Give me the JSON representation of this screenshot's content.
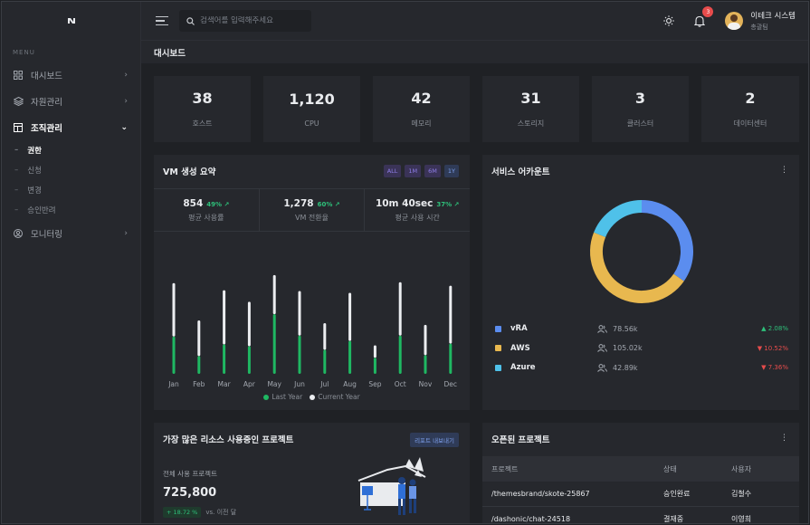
{
  "sidebar": {
    "menu_title": "MENU",
    "items": [
      {
        "label": "대시보드",
        "expanded": false
      },
      {
        "label": "자원관리",
        "expanded": false
      },
      {
        "label": "조직관리",
        "expanded": true
      },
      {
        "label": "모니터링",
        "expanded": false
      }
    ],
    "subitems": [
      "권한",
      "신청",
      "변경",
      "승인반려"
    ]
  },
  "topbar": {
    "search_placeholder": "검색어를 입력해주세요",
    "notification_count": "3",
    "user_name": "이테크 시스템",
    "user_role": "총괄팀"
  },
  "page_title": "대시보드",
  "stats": [
    {
      "value": "38",
      "label": "호스트"
    },
    {
      "value": "1,120",
      "label": "CPU"
    },
    {
      "value": "42",
      "label": "메모리"
    },
    {
      "value": "31",
      "label": "스토리지"
    },
    {
      "value": "3",
      "label": "클러스터"
    },
    {
      "value": "2",
      "label": "데이터센터"
    }
  ],
  "vm_card": {
    "title": "VM 생성 요약",
    "ranges": [
      "ALL",
      "1M",
      "6M",
      "1Y"
    ],
    "selected_range": "1Y",
    "metrics": [
      {
        "value": "854",
        "growth": "49% ↗",
        "label": "평균 사용률"
      },
      {
        "value": "1,278",
        "growth": "60% ↗",
        "label": "VM 전환율"
      },
      {
        "value": "10m 40sec",
        "growth": "37% ↗",
        "label": "평균 사용 시간"
      }
    ]
  },
  "chart_data": {
    "type": "bar",
    "categories": [
      "Jan",
      "Feb",
      "Mar",
      "Apr",
      "May",
      "Jun",
      "Jul",
      "Aug",
      "Sep",
      "Oct",
      "Nov",
      "Dec"
    ],
    "series": [
      {
        "name": "Last Year",
        "color": "#1fb862",
        "values": [
          42,
          20,
          33,
          31,
          67,
          43,
          27,
          37,
          18,
          43,
          21,
          34
        ]
      },
      {
        "name": "Current Year",
        "color": "#eceef1",
        "values": [
          60,
          40,
          61,
          50,
          44,
          50,
          30,
          54,
          14,
          60,
          34,
          65
        ]
      }
    ],
    "stacked": true,
    "ylim": [
      0,
      120
    ],
    "grid": false,
    "legend": "bottom-center"
  },
  "service_card": {
    "title": "서비스 어카운트",
    "donut": [
      {
        "name": "vRA",
        "value": 78.56,
        "color": "#5b8def"
      },
      {
        "name": "AWS",
        "value": 105.02,
        "color": "#e8b84f"
      },
      {
        "name": "Azure",
        "value": 42.89,
        "color": "#4fc1e9"
      }
    ],
    "rows": [
      {
        "name": "vRA",
        "users": "78.56k",
        "change": "2.08%",
        "dir": "up",
        "color": "#5b8def"
      },
      {
        "name": "AWS",
        "users": "105.02k",
        "change": "10.52%",
        "dir": "down",
        "color": "#e8b84f"
      },
      {
        "name": "Azure",
        "users": "42.89k",
        "change": "7.36%",
        "dir": "down",
        "color": "#4fc1e9"
      }
    ]
  },
  "project_card": {
    "title": "가장 많은 리소스 사용중인 프로젝트",
    "export_label": "리포트 내보내기",
    "total_label": "전체 사용 프로젝트",
    "total_value": "725,800",
    "change": "+ 18.72 %",
    "change_suffix": "vs. 이전 달"
  },
  "open_projects": {
    "title": "오픈된 프로젝트",
    "columns": [
      "프로젝트",
      "상태",
      "사용자"
    ],
    "rows": [
      [
        "/themesbrand/skote-25867",
        "승인완료",
        "김철수"
      ],
      [
        "/dashonic/chat-24518",
        "결재중",
        "이영희"
      ]
    ]
  }
}
